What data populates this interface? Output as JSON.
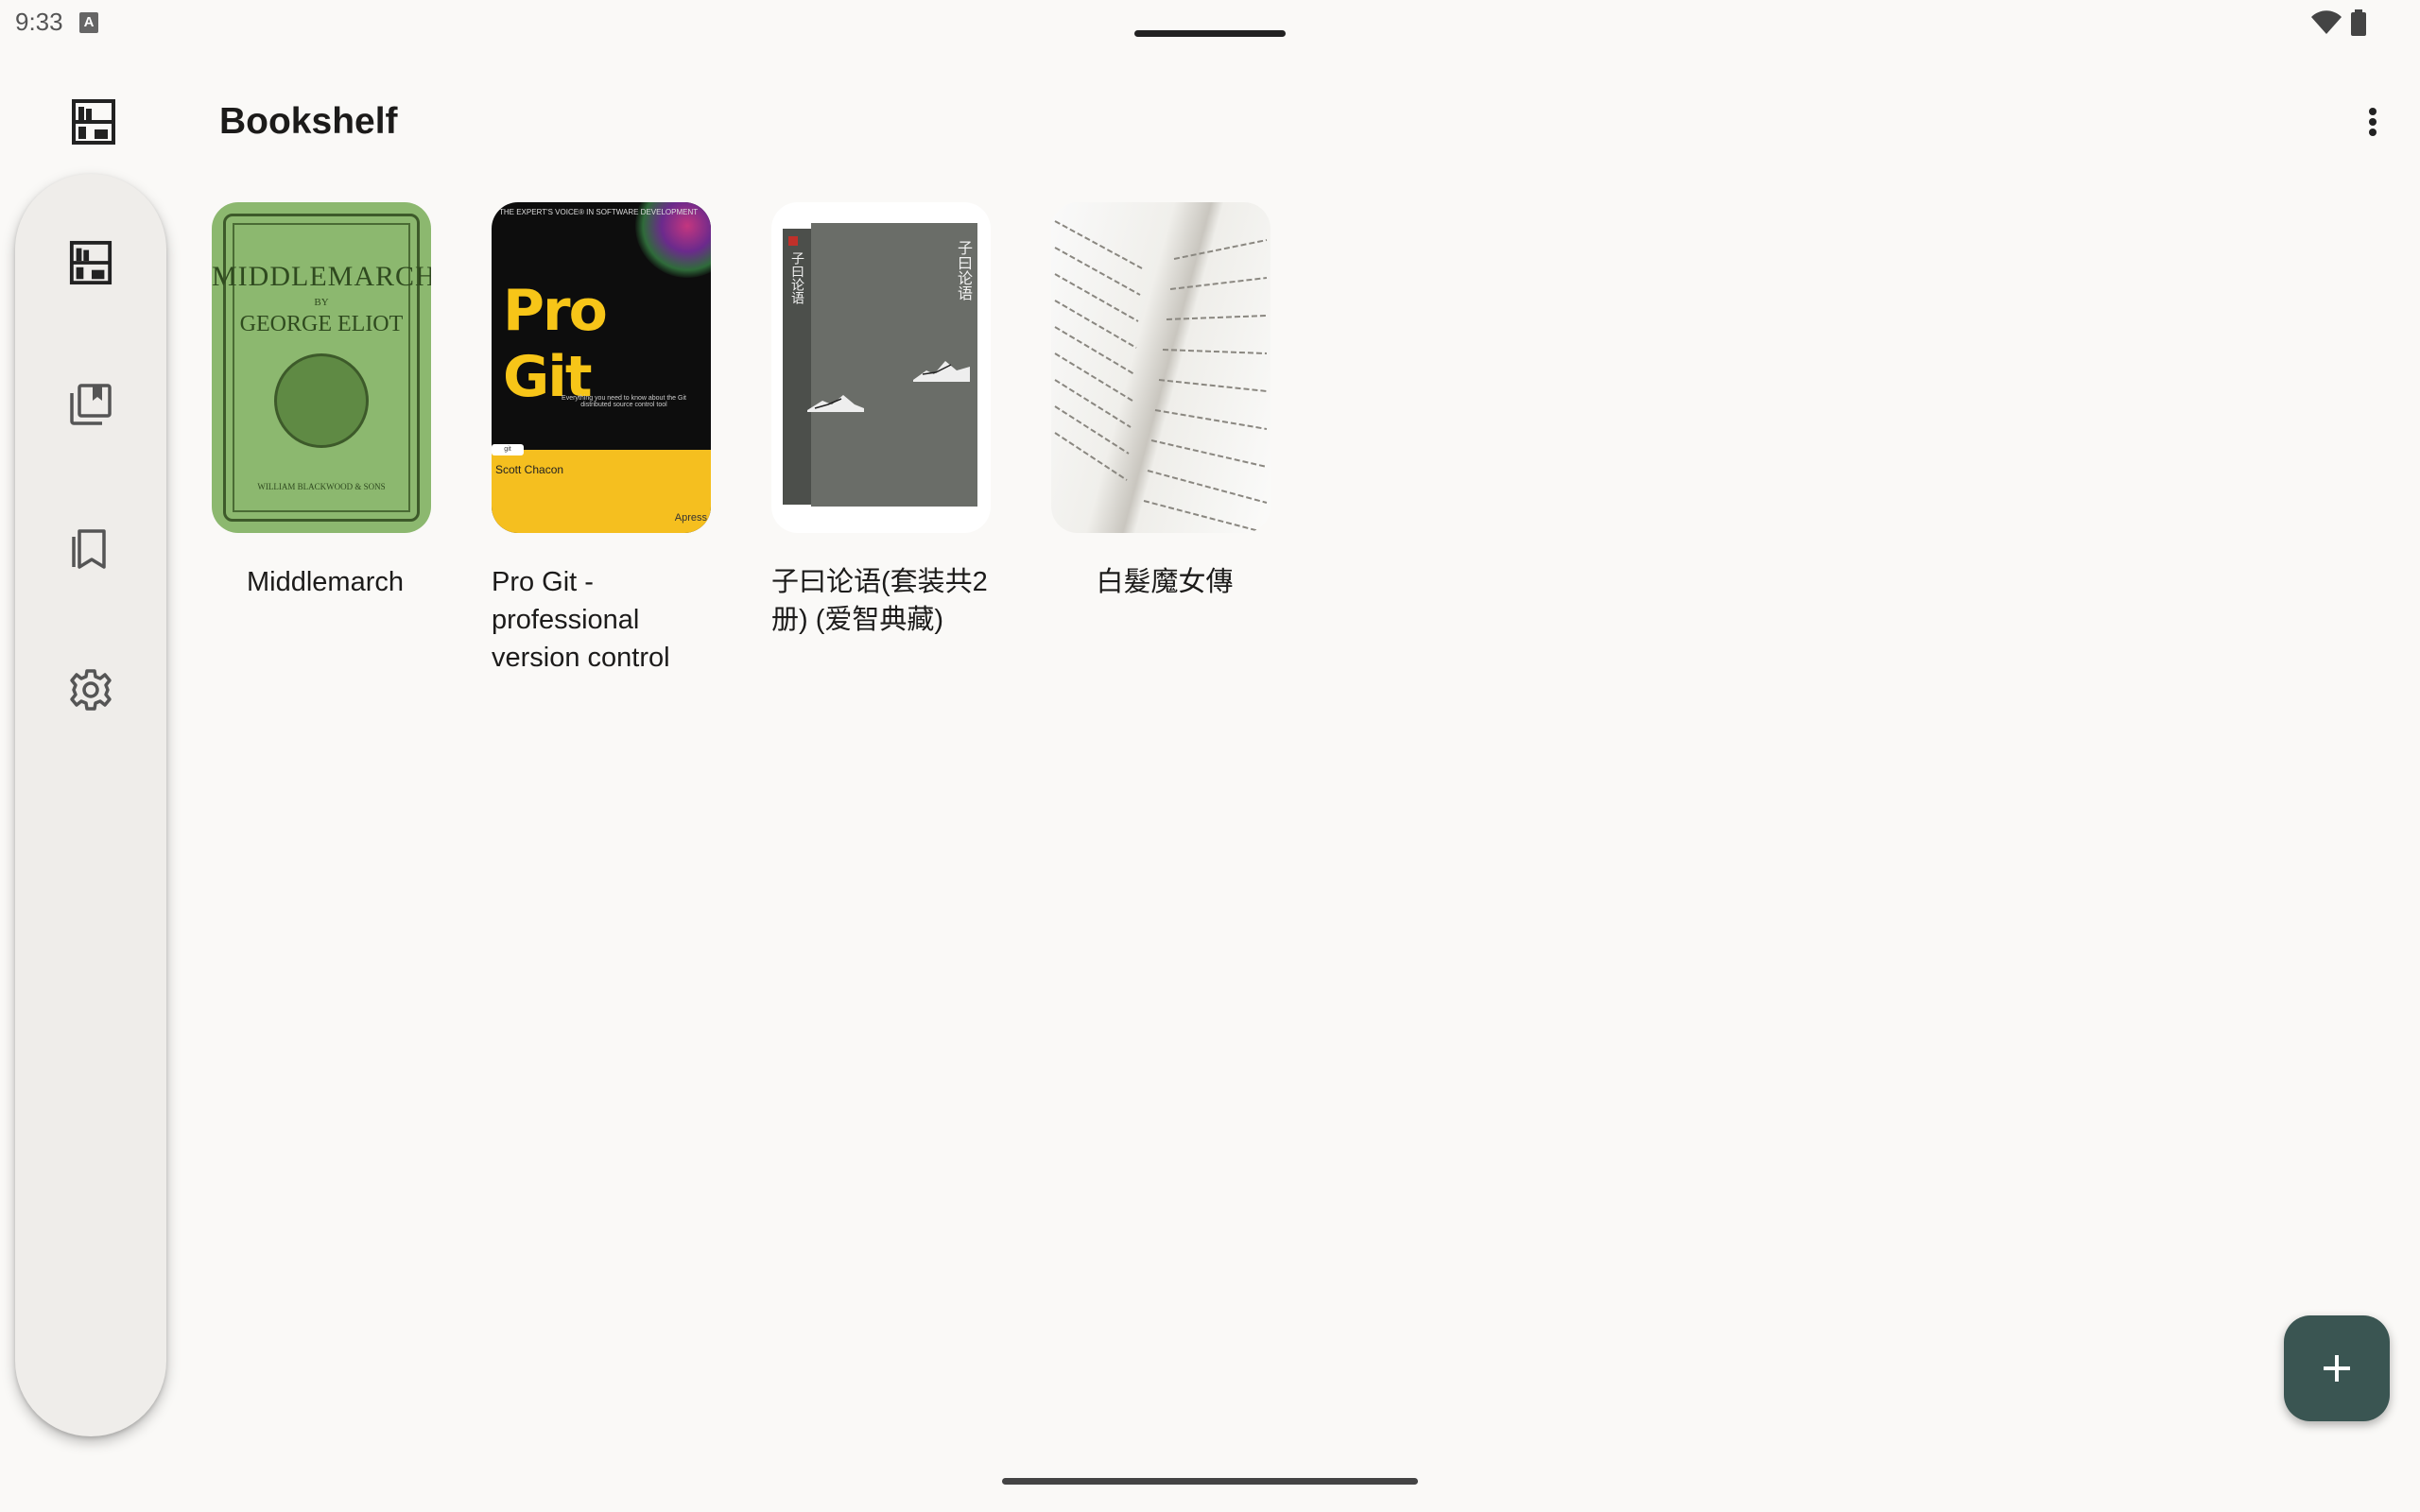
{
  "status_bar": {
    "time": "9:33",
    "notification_icon": "a-icon",
    "icons": [
      "wifi-icon",
      "battery-icon"
    ]
  },
  "app_bar": {
    "title": "Bookshelf",
    "leading_icon": "shelf-icon",
    "trailing_icon": "more-vert-icon"
  },
  "nav_rail": {
    "items": [
      {
        "icon": "shelf-icon",
        "selected": true
      },
      {
        "icon": "library-icon",
        "selected": false
      },
      {
        "icon": "bookmarks-icon",
        "selected": false
      },
      {
        "icon": "settings-icon",
        "selected": false
      }
    ]
  },
  "books": [
    {
      "title": "Middlemarch",
      "cover": {
        "title": "MIDDLEMARCH",
        "by": "BY",
        "author": "GEORGE ELIOT",
        "publisher": "WILLIAM BLACKWOOD & SONS"
      }
    },
    {
      "title": "Pro Git - professional version control",
      "cover": {
        "top_text": "THE EXPERT'S VOICE® IN SOFTWARE DEVELOPMENT",
        "title": "Pro Git",
        "subtitle": "Everything you need to know about the Git distributed source control tool",
        "tag": "git",
        "author": "Scott Chacon",
        "publisher": "Apress"
      }
    },
    {
      "title": "子曰论语(套装共2册) (爱智典藏)",
      "cover": {
        "title": "子曰论语",
        "spine": "子曰论语"
      }
    },
    {
      "title": "白髮魔女傳",
      "cover": {}
    }
  ],
  "fab": {
    "icon": "add-icon"
  },
  "colors": {
    "background": "#faf9f7",
    "rail": "#efedea",
    "fab": "#3a5552",
    "text": "#1c1b1a"
  }
}
